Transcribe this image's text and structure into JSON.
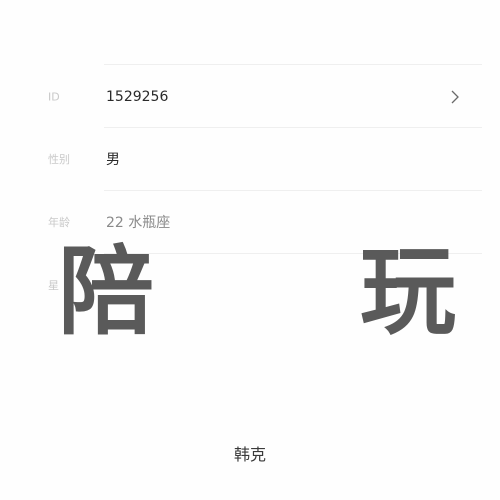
{
  "rows": {
    "id": {
      "label": "ID",
      "value": "1529256"
    },
    "gender": {
      "label": "性别",
      "value": "男"
    },
    "age": {
      "label": "年龄",
      "value": "22 水瓶座"
    },
    "fourth": {
      "label": "星"
    }
  },
  "overlay": {
    "left_char": "陪",
    "right_char": "玩"
  },
  "footer": {
    "name": "韩克"
  },
  "icons": {
    "row_chevron": "chevron-right-icon"
  }
}
